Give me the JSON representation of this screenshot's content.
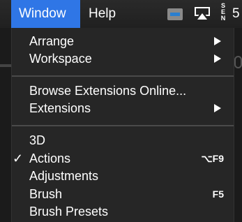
{
  "menubar": {
    "window_label": "Window",
    "help_label": "Help",
    "status": {
      "gopro_icon": "gopro-icon",
      "airplay_icon": "airplay-icon",
      "sen_letters": [
        "S",
        "E",
        "N"
      ],
      "battery_text": "5"
    }
  },
  "colors": {
    "accent": "#2f76e6",
    "menu_bg": "#262626",
    "separator": "#4a4a4a",
    "text": "#ffffff"
  },
  "menu": {
    "items": [
      {
        "label": "Arrange",
        "submenu": true
      },
      {
        "label": "Workspace",
        "submenu": true
      },
      {
        "label": "Browse Extensions Online..."
      },
      {
        "label": "Extensions",
        "submenu": true
      },
      {
        "label": "3D"
      },
      {
        "label": "Actions",
        "checked": true,
        "shortcut": "⌥F9"
      },
      {
        "label": "Adjustments"
      },
      {
        "label": "Brush",
        "shortcut": "F5"
      },
      {
        "label": "Brush Presets"
      }
    ],
    "check_glyph": "✓"
  }
}
